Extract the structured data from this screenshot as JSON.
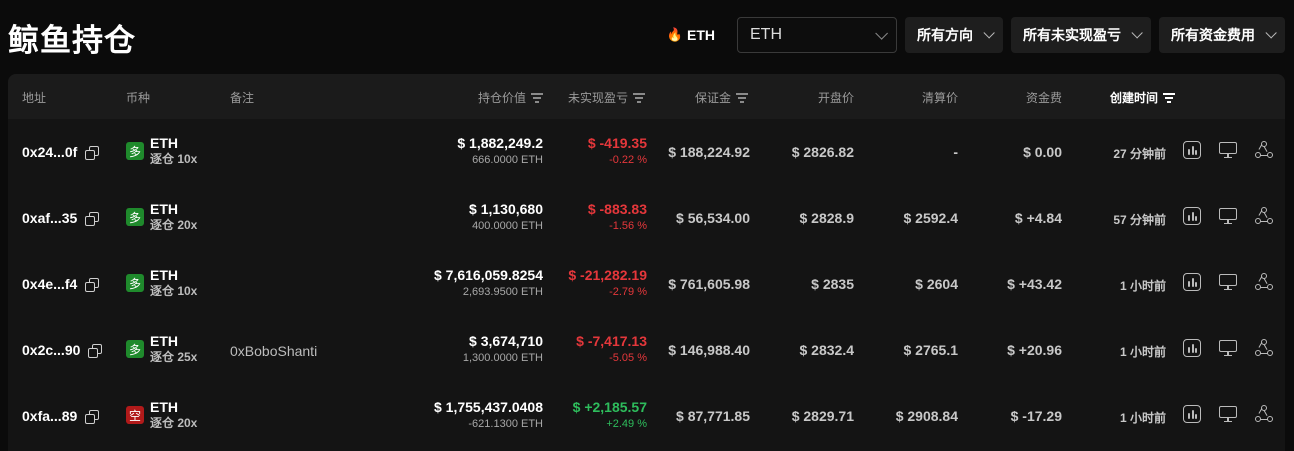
{
  "page_title": "鲸鱼持仓",
  "filters": {
    "coin_chip": "ETH",
    "coin_select_value": "ETH",
    "direction": "所有方向",
    "unrealized_pnl": "所有未实现盈亏",
    "funding_fee": "所有资金费用"
  },
  "columns": {
    "address": "地址",
    "coin": "币种",
    "note": "备注",
    "position_value": "持仓价值",
    "unrealized_pnl": "未实现盈亏",
    "margin": "保证金",
    "entry_price": "开盘价",
    "liq_price": "清算价",
    "funding_fee": "资金费",
    "created_time": "创建时间"
  },
  "colors": {
    "long": "#1f8a2c",
    "short": "#b11a1a",
    "positive": "#2ebd5c",
    "negative": "#e5373b"
  },
  "rows": [
    {
      "address": "0x24...0f",
      "side": "long",
      "side_label": "多",
      "coin": "ETH",
      "leverage": "逐仓 10x",
      "note": "",
      "value": "$ 1,882,249.2",
      "amount": "666.0000 ETH",
      "pnl": "$ -419.35",
      "pnl_pct": "-0.22 %",
      "pnl_sign": "neg",
      "margin": "$ 188,224.92",
      "entry": "$ 2826.82",
      "liq": "-",
      "funding": "$ 0.00",
      "funding_sign": "zero",
      "time": "27 分钟前"
    },
    {
      "address": "0xaf...35",
      "side": "long",
      "side_label": "多",
      "coin": "ETH",
      "leverage": "逐仓 20x",
      "note": "",
      "value": "$ 1,130,680",
      "amount": "400.0000 ETH",
      "pnl": "$ -883.83",
      "pnl_pct": "-1.56 %",
      "pnl_sign": "neg",
      "margin": "$ 56,534.00",
      "entry": "$ 2828.9",
      "liq": "$ 2592.4",
      "funding": "$ +4.84",
      "funding_sign": "pos",
      "time": "57 分钟前"
    },
    {
      "address": "0x4e...f4",
      "side": "long",
      "side_label": "多",
      "coin": "ETH",
      "leverage": "逐仓 10x",
      "note": "",
      "value": "$ 7,616,059.8254",
      "amount": "2,693.9500 ETH",
      "pnl": "$ -21,282.19",
      "pnl_pct": "-2.79 %",
      "pnl_sign": "neg",
      "margin": "$ 761,605.98",
      "entry": "$ 2835",
      "liq": "$ 2604",
      "funding": "$ +43.42",
      "funding_sign": "pos",
      "time": "1 小时前"
    },
    {
      "address": "0x2c...90",
      "side": "long",
      "side_label": "多",
      "coin": "ETH",
      "leverage": "逐仓 25x",
      "note": "0xBoboShanti",
      "value": "$ 3,674,710",
      "amount": "1,300.0000 ETH",
      "pnl": "$ -7,417.13",
      "pnl_pct": "-5.05 %",
      "pnl_sign": "neg",
      "margin": "$ 146,988.40",
      "entry": "$ 2832.4",
      "liq": "$ 2765.1",
      "funding": "$ +20.96",
      "funding_sign": "pos",
      "time": "1 小时前"
    },
    {
      "address": "0xfa...89",
      "side": "short",
      "side_label": "空",
      "coin": "ETH",
      "leverage": "逐仓 20x",
      "note": "",
      "value": "$ 1,755,437.0408",
      "amount": "-621.1300 ETH",
      "pnl": "$ +2,185.57",
      "pnl_pct": "+2.49 %",
      "pnl_sign": "pos",
      "margin": "$ 87,771.85",
      "entry": "$ 2829.71",
      "liq": "$ 2908.84",
      "funding": "$ -17.29",
      "funding_sign": "neg",
      "time": "1 小时前"
    }
  ]
}
